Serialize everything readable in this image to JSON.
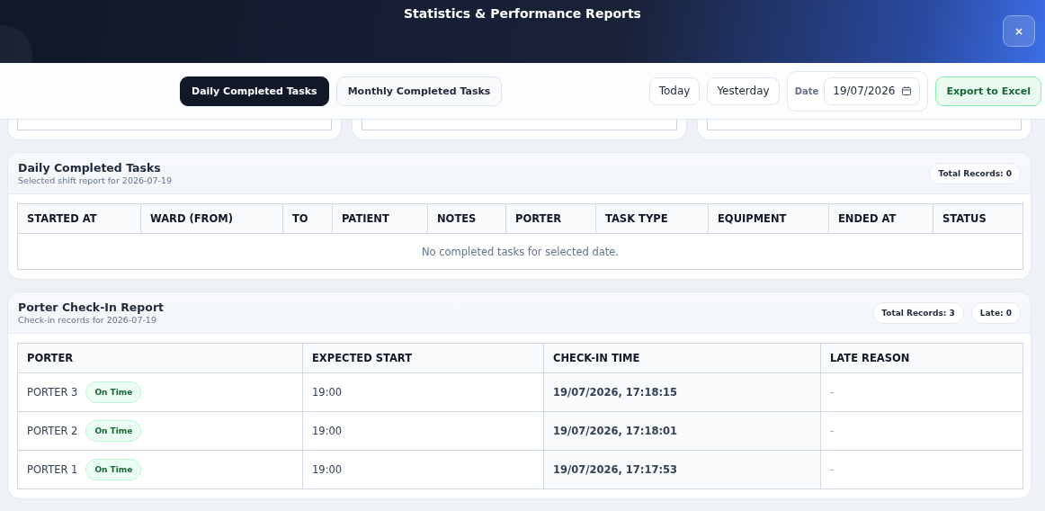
{
  "window": {
    "title": "Statistics & Performance Reports",
    "close": "×"
  },
  "tabs": [
    {
      "label": "Daily Completed Tasks",
      "selected": true
    },
    {
      "label": "Monthly Completed Tasks",
      "selected": false
    }
  ],
  "quick_buttons": [
    "Today",
    "Yesterday"
  ],
  "date_field": {
    "label": "Date",
    "value": "19/07/2026"
  },
  "export_button": "Export to Excel",
  "daily": {
    "title": "Daily Completed Tasks",
    "subtitle": "Selected shift report for 2026-07-19",
    "badges": [
      "Total Records: 0"
    ],
    "columns": [
      "STARTED AT",
      "WARD (FROM)",
      "TO",
      "PATIENT",
      "NOTES",
      "PORTER",
      "TASK TYPE",
      "EQUIPMENT",
      "ENDED AT",
      "STATUS"
    ],
    "empty_message": "No completed tasks for selected date."
  },
  "checkins": {
    "title": "Porter Check-In Report",
    "subtitle": "Check-in records for 2026-07-19",
    "badges": [
      "Total Records: 3",
      "Late: 0"
    ],
    "columns": [
      "PORTER",
      "EXPECTED START",
      "CHECK-IN TIME",
      "LATE REASON"
    ],
    "rows": [
      {
        "porter": "PORTER 3",
        "status": {
          "label": "On Time",
          "kind": "on_time"
        },
        "expected_start": "19:00",
        "check_in_time": "19/07/2026, 17:18:15",
        "late_reason": "-"
      },
      {
        "porter": "PORTER 2",
        "status": {
          "label": "On Time",
          "kind": "on_time"
        },
        "expected_start": "19:00",
        "check_in_time": "19/07/2026, 17:18:01",
        "late_reason": "-"
      },
      {
        "porter": "PORTER 1",
        "status": {
          "label": "On Time",
          "kind": "on_time"
        },
        "expected_start": "19:00",
        "check_in_time": "19/07/2026, 17:17:53",
        "late_reason": "-"
      }
    ]
  }
}
